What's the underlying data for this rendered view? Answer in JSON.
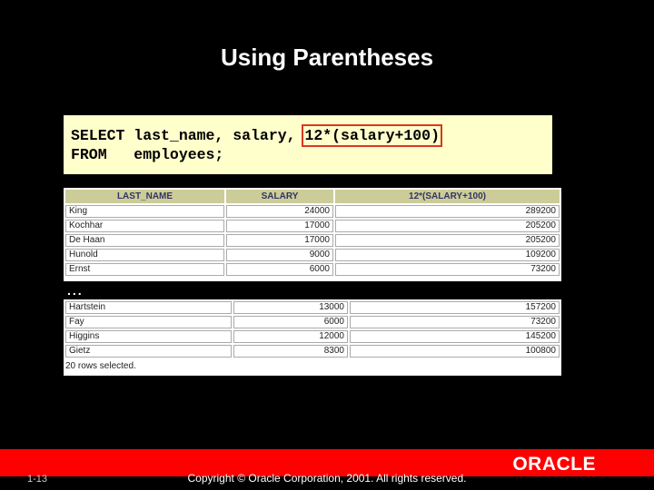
{
  "slide": {
    "title": "Using Parentheses",
    "page_number": "1-13",
    "copyright": "Copyright © Oracle Corporation, 2001. All rights reserved.",
    "logo": "ORACLE",
    "colors": {
      "background": "#000000",
      "band": "#ff0000",
      "code_bg": "#ffffcc",
      "highlight": "#d9381e",
      "table_header": "#cccc99"
    }
  },
  "code": {
    "line1_prefix": "SELECT last_name, salary, ",
    "line1_highlight": "12*(salary+100)",
    "line2": "FROM   employees;"
  },
  "results": {
    "columns": [
      "LAST_NAME",
      "SALARY",
      "12*(SALARY+100)"
    ],
    "rows_top": [
      [
        "King",
        "24000",
        "289200"
      ],
      [
        "Kochhar",
        "17000",
        "205200"
      ],
      [
        "De Haan",
        "17000",
        "205200"
      ],
      [
        "Hunold",
        "9000",
        "109200"
      ],
      [
        "Ernst",
        "6000",
        "73200"
      ]
    ],
    "ellipsis": "...",
    "rows_bottom": [
      [
        "Hartstein",
        "13000",
        "157200"
      ],
      [
        "Fay",
        "6000",
        "73200"
      ],
      [
        "Higgins",
        "12000",
        "145200"
      ],
      [
        "Gietz",
        "8300",
        "100800"
      ]
    ],
    "status": "20 rows selected."
  }
}
